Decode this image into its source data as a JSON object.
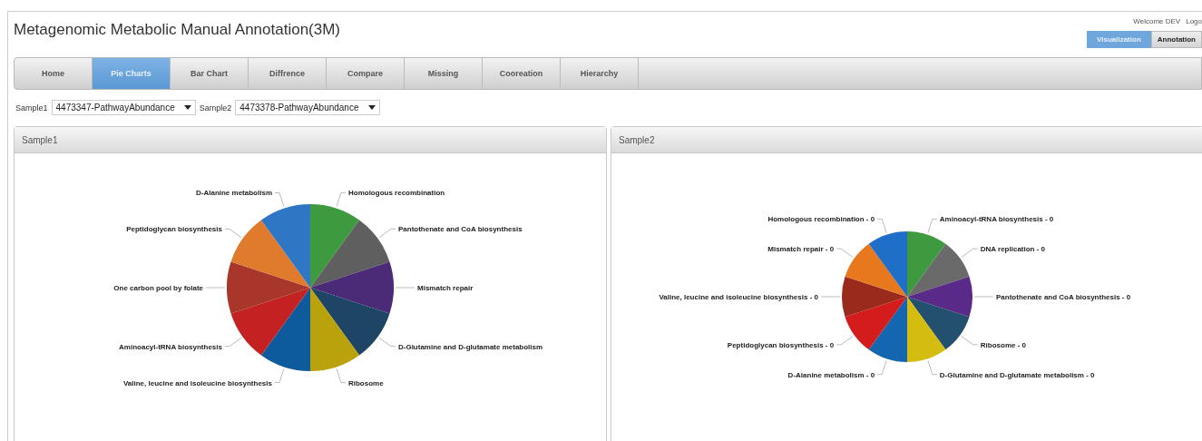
{
  "title": "Metagenomic Metabolic Manual Annotation(3M)",
  "user_bar": {
    "welcome": "Welcome DEV",
    "logout": "Logo"
  },
  "mode_buttons": [
    {
      "label": "Visualization",
      "selected": true
    },
    {
      "label": "Annotation",
      "selected": false
    }
  ],
  "tabs": [
    {
      "label": "Home",
      "selected": false
    },
    {
      "label": "Pie Charts",
      "selected": true
    },
    {
      "label": "Bar Chart",
      "selected": false
    },
    {
      "label": "Diffrence",
      "selected": false
    },
    {
      "label": "Compare",
      "selected": false
    },
    {
      "label": "Missing",
      "selected": false
    },
    {
      "label": "Cooreation",
      "selected": false
    },
    {
      "label": "Hierarchy",
      "selected": false
    }
  ],
  "selectors": [
    {
      "label": "Sample1",
      "value": "4473347-PathwayAbundance"
    },
    {
      "label": "Sample2",
      "value": "4473378-PathwayAbundance"
    }
  ],
  "panels": [
    {
      "title": "Sample1",
      "left_slices": [
        {
          "label": "D-Alanine metabolism",
          "color": "#2f77c4"
        },
        {
          "label": "Peptidoglycan biosynthesis",
          "color": "#e07a2c"
        },
        {
          "label": "One carbon pool by folate",
          "color": "#a8362a"
        },
        {
          "label": "Aminoacyl-tRNA biosynthesis",
          "color": "#c42222"
        },
        {
          "label": "Valine, leucine and isoleucine biosynthesis",
          "color": "#0d5a9c"
        }
      ],
      "right_slices": [
        {
          "label": "Homologous recombination",
          "color": "#3e9a3e"
        },
        {
          "label": "Pantothenate and CoA biosynthesis",
          "color": "#5f5f5f"
        },
        {
          "label": "Mismatch repair",
          "color": "#4b2a78"
        },
        {
          "label": "D-Glutamine and D-glutamate metabolism",
          "color": "#1f4566"
        },
        {
          "label": "Ribosome",
          "color": "#b9a20c"
        }
      ]
    },
    {
      "title": "Sample2",
      "left_slices": [
        {
          "label": "Homologous recombination - 0",
          "color": "#1f6fc8"
        },
        {
          "label": "Mismatch repair - 0",
          "color": "#e8781e"
        },
        {
          "label": "Valine, leucine and isoleucine biosynthesis - 0",
          "color": "#9a2a1c"
        },
        {
          "label": "Peptidoglycan biosynthesis - 0",
          "color": "#d41c1c"
        },
        {
          "label": "D-Alanine metabolism - 0",
          "color": "#1466b0"
        }
      ],
      "right_slices": [
        {
          "label": "Aminoacyl-tRNA biosynthesis - 0",
          "color": "#3e9a3e"
        },
        {
          "label": "DNA replication - 0",
          "color": "#6a6a6a"
        },
        {
          "label": "Pantothenate and CoA biosynthesis - 0",
          "color": "#5a2a88"
        },
        {
          "label": "Ribosome - 0",
          "color": "#245070"
        },
        {
          "label": "D-Glutamine and D-glutamate metabolism - 0",
          "color": "#d4bc10"
        }
      ]
    }
  ]
}
